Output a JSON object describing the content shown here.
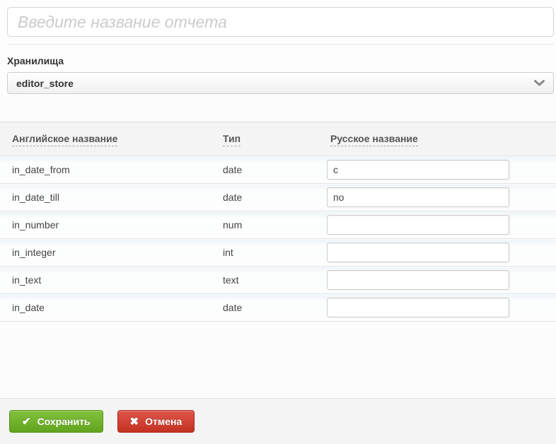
{
  "report_form": {
    "name_placeholder": "Введите название отчета",
    "name_value": ""
  },
  "storage": {
    "label": "Хранилища",
    "selected_option": "editor_store"
  },
  "params_table": {
    "columns": [
      {
        "label": "Английское название"
      },
      {
        "label": "Тип"
      },
      {
        "label": "Русское название"
      }
    ],
    "rows": [
      {
        "en": "in_date_from",
        "type": "date",
        "ru": "с"
      },
      {
        "en": "in_date_till",
        "type": "date",
        "ru": "по"
      },
      {
        "en": "in_number",
        "type": "num",
        "ru": ""
      },
      {
        "en": "in_integer",
        "type": "int",
        "ru": ""
      },
      {
        "en": "in_text",
        "type": "text",
        "ru": ""
      },
      {
        "en": "in_date",
        "type": "date",
        "ru": ""
      }
    ]
  },
  "footer": {
    "save_button": {
      "label": "Сохранить",
      "icon": "check-icon",
      "glyph": "✔"
    },
    "cancel_button": {
      "label": "Отмена",
      "icon": "x-icon",
      "glyph": "✖"
    }
  },
  "colors": {
    "save_green_top": "#82c13e",
    "save_green_bottom": "#61a41d",
    "cancel_red_top": "#e0544a",
    "cancel_red_bottom": "#c23222",
    "table_header_bg": "#f4f4f4",
    "row_separator": "#dde4ea",
    "footer_bg": "#f4f4f4",
    "placeholder_gray": "#cbcbcb"
  }
}
